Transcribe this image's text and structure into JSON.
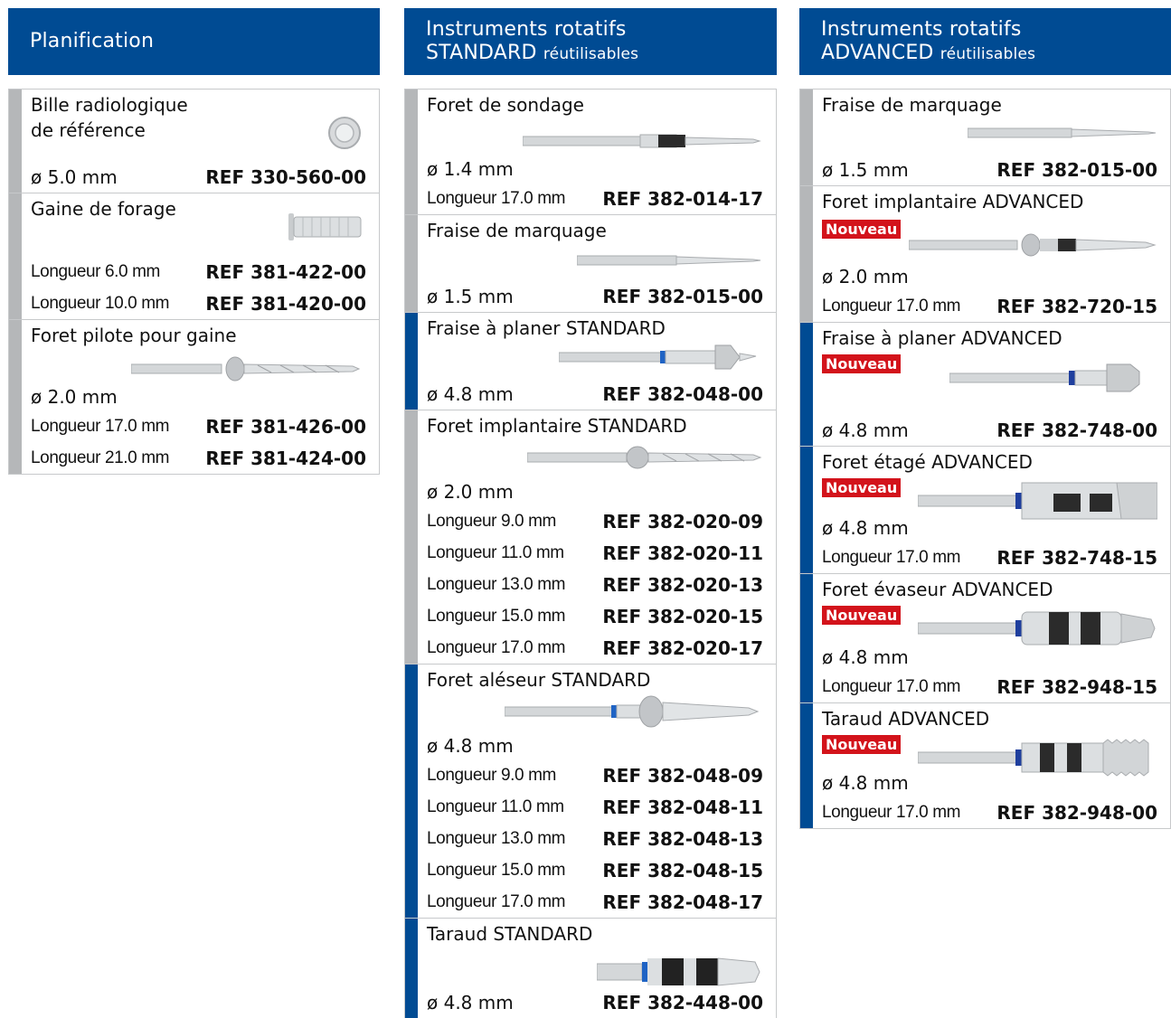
{
  "columns": [
    {
      "title": "Planification",
      "subtitle": "",
      "items": [
        {
          "name": "Bille radiologique\nde référence",
          "bar": "grey",
          "icon": "ball-icon",
          "diameter": "ø 5.0 mm",
          "ref_inline": "REF 330-560-00",
          "rows": []
        },
        {
          "name": "Gaine de forage",
          "bar": "grey",
          "icon": "sleeve-icon",
          "diameter": "",
          "ref_inline": "",
          "rows": [
            {
              "spec": "Longueur 6.0 mm",
              "ref": "REF 381-422-00"
            },
            {
              "spec": "Longueur 10.0 mm",
              "ref": "REF 381-420-00"
            }
          ]
        },
        {
          "name": "Foret pilote pour gaine",
          "bar": "grey",
          "icon": "drill-icon",
          "diameter": "ø 2.0 mm",
          "ref_inline": "",
          "rows": [
            {
              "spec": "Longueur 17.0 mm",
              "ref": "REF 381-426-00"
            },
            {
              "spec": "Longueur 21.0 mm",
              "ref": "REF 381-424-00"
            }
          ]
        }
      ]
    },
    {
      "title": "Instruments rotatifs",
      "subtitle_main": "STANDARD",
      "subtitle": "réutilisables",
      "items": [
        {
          "name": "Foret de sondage",
          "bar": "grey",
          "icon": "drill-icon",
          "diameter": "ø 1.4 mm",
          "ref_inline": "",
          "rows": [
            {
              "spec": "Longueur 17.0 mm",
              "ref": "REF 382-014-17"
            }
          ]
        },
        {
          "name": "Fraise de marquage",
          "bar": "grey",
          "icon": "drill-icon",
          "diameter": "ø 1.5 mm",
          "ref_inline": "REF 382-015-00",
          "rows": []
        },
        {
          "name": "Fraise à planer STANDARD",
          "bar": "blue",
          "icon": "drill-icon",
          "diameter": "ø 4.8 mm",
          "ref_inline": "REF 382-048-00",
          "rows": []
        },
        {
          "name": "Foret implantaire STANDARD",
          "bar": "grey",
          "icon": "drill-icon",
          "diameter": "ø 2.0 mm",
          "ref_inline": "",
          "rows": [
            {
              "spec": "Longueur 9.0 mm",
              "ref": "REF 382-020-09"
            },
            {
              "spec": "Longueur 11.0 mm",
              "ref": "REF 382-020-11"
            },
            {
              "spec": "Longueur 13.0 mm",
              "ref": "REF 382-020-13"
            },
            {
              "spec": "Longueur 15.0 mm",
              "ref": "REF 382-020-15"
            },
            {
              "spec": "Longueur 17.0 mm",
              "ref": "REF 382-020-17"
            }
          ]
        },
        {
          "name": "Foret aléseur STANDARD",
          "bar": "blue",
          "icon": "drill-icon",
          "diameter": "ø 4.8 mm",
          "ref_inline": "",
          "rows": [
            {
              "spec": "Longueur 9.0 mm",
              "ref": "REF 382-048-09"
            },
            {
              "spec": "Longueur 11.0 mm",
              "ref": "REF 382-048-11"
            },
            {
              "spec": "Longueur 13.0 mm",
              "ref": "REF 382-048-13"
            },
            {
              "spec": "Longueur 15.0 mm",
              "ref": "REF 382-048-15"
            },
            {
              "spec": "Longueur 17.0 mm",
              "ref": "REF 382-048-17"
            }
          ]
        },
        {
          "name": "Taraud STANDARD",
          "bar": "blue",
          "icon": "tap-icon",
          "diameter": "ø 4.8 mm",
          "ref_inline": "REF 382-448-00",
          "rows": []
        }
      ]
    },
    {
      "title": "Instruments rotatifs",
      "subtitle_main": "ADVANCED",
      "subtitle": "réutilisables",
      "items": [
        {
          "name": "Fraise de marquage",
          "bar": "grey",
          "icon": "drill-icon",
          "diameter": "ø 1.5 mm",
          "ref_inline": "REF 382-015-00",
          "rows": []
        },
        {
          "name": "Foret implantaire ADVANCED",
          "bar": "grey",
          "badge": "Nouveau",
          "icon": "drill-icon",
          "diameter": "ø 2.0 mm",
          "ref_inline": "",
          "rows": [
            {
              "spec": "Longueur 17.0 mm",
              "ref": "REF 382-720-15"
            }
          ]
        },
        {
          "name": "Fraise à planer ADVANCED",
          "bar": "blue",
          "badge": "Nouveau",
          "icon": "drill-icon",
          "diameter": "ø 4.8 mm",
          "ref_inline": "REF 382-748-00",
          "rows": []
        },
        {
          "name": "Foret étagé ADVANCED",
          "bar": "blue",
          "badge": "Nouveau",
          "icon": "drill-icon",
          "diameter": "ø 4.8 mm",
          "ref_inline": "",
          "rows": [
            {
              "spec": "Longueur 17.0 mm",
              "ref": "REF 382-748-15"
            }
          ]
        },
        {
          "name": "Foret évaseur ADVANCED",
          "bar": "blue",
          "badge": "Nouveau",
          "icon": "drill-icon",
          "diameter": "ø 4.8 mm",
          "ref_inline": "",
          "rows": [
            {
              "spec": "Longueur 17.0 mm",
              "ref": "REF 382-948-15"
            }
          ]
        },
        {
          "name": "Taraud ADVANCED",
          "bar": "blue",
          "badge": "Nouveau",
          "icon": "tap-icon",
          "diameter": "ø 4.8 mm",
          "ref_inline": "",
          "rows": [
            {
              "spec": "Longueur 17.0 mm",
              "ref": "REF 382-948-00"
            }
          ]
        }
      ]
    }
  ],
  "colors": {
    "header_blue": "#004b93",
    "bar_grey": "#b5b7b9",
    "badge_red": "#d3131b"
  }
}
